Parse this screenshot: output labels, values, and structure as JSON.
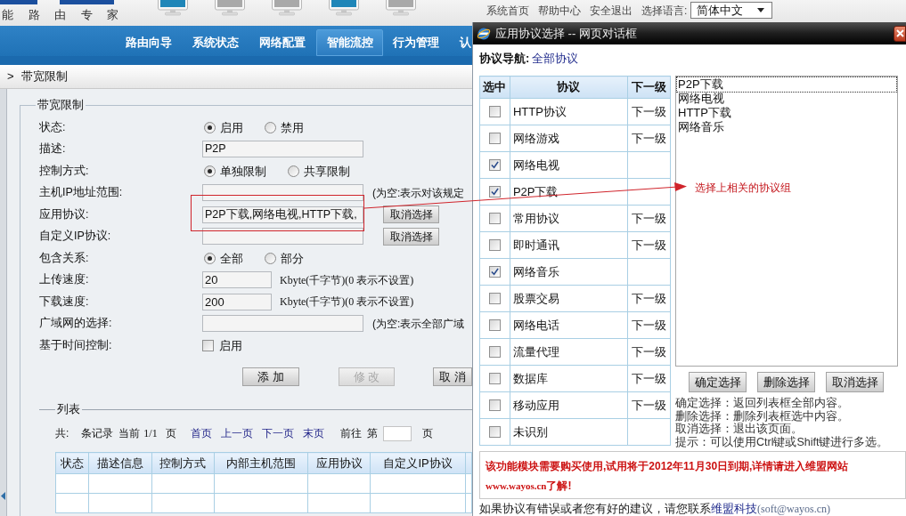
{
  "header": {
    "tagline": "能 路 由 专 家",
    "monitors": [
      {
        "on": true
      },
      {
        "on": false
      },
      {
        "on": false
      },
      {
        "on": true
      },
      {
        "on": false
      }
    ],
    "links": [
      "系统首页",
      "帮助中心",
      "安全退出"
    ],
    "language_label": "选择语言:",
    "language_value": "简体中文"
  },
  "nav": {
    "tabs": [
      {
        "label": "路由向导",
        "selected": false
      },
      {
        "label": "系统状态",
        "selected": false
      },
      {
        "label": "网络配置",
        "selected": false
      },
      {
        "label": "智能流控",
        "selected": true
      },
      {
        "label": "行为管理",
        "selected": false
      },
      {
        "label": "认",
        "selected": false
      }
    ]
  },
  "breadcrumb": {
    "separator": ">",
    "current": "带宽限制"
  },
  "form": {
    "legend": "带宽限制",
    "rows": [
      {
        "kind": "radio",
        "label": "状态:",
        "options": [
          {
            "label": "启用",
            "selected": true
          },
          {
            "label": "禁用",
            "selected": false
          }
        ]
      },
      {
        "kind": "text",
        "label": "描述:",
        "value": "P2P"
      },
      {
        "kind": "radio",
        "label": "控制方式:",
        "options": [
          {
            "label": "单独限制",
            "selected": true
          },
          {
            "label": "共享限制",
            "selected": false
          }
        ]
      },
      {
        "kind": "text",
        "label": "主机IP地址范围:",
        "hint": "(为空:表示对该规定"
      },
      {
        "kind": "text",
        "label": "应用协议:",
        "value": "P2P下载,网络电视,HTTP下载,",
        "button": "取消选择"
      },
      {
        "kind": "text",
        "label": "自定义IP协议:",
        "button": "取消选择"
      },
      {
        "kind": "radio",
        "label": "包含关系:",
        "options": [
          {
            "label": "全部",
            "selected": true
          },
          {
            "label": "部分",
            "selected": false
          }
        ]
      },
      {
        "kind": "speed",
        "label": "上传速度:",
        "value": "20",
        "unit": "Kbyte(千字节)(0 表示不设置)"
      },
      {
        "kind": "speed",
        "label": "下载速度:",
        "value": "200",
        "unit": "Kbyte(千字节)(0 表示不设置)"
      },
      {
        "kind": "text",
        "label": "广域网的选择:",
        "hint": "(为空:表示全部广域"
      },
      {
        "kind": "checkbox",
        "label": "基于时间控制:",
        "checked": false,
        "text": "启用"
      }
    ],
    "buttons": [
      {
        "label": "添 加",
        "disabled": false
      },
      {
        "label": "修 改",
        "disabled": true
      },
      {
        "label": "取 消",
        "disabled": false
      }
    ]
  },
  "list": {
    "legend": "列表",
    "pager": {
      "total_label": "共:",
      "records_label": "条记录",
      "current_label": "当前",
      "page": "1/1",
      "page_unit": "页",
      "links": [
        "首页",
        "上一页",
        "下一页",
        "末页"
      ],
      "goto_label": "前往",
      "goto_prefix": "第",
      "goto_suffix": "页"
    },
    "table": {
      "columns": [
        "状态",
        "描述信息",
        "控制方式",
        "内部主机范围",
        "应用协议",
        "自定义IP协议"
      ]
    }
  },
  "dialog": {
    "title": "应用协议选择 -- 网页对话框",
    "nav_label": "协议导航:",
    "nav_link": "全部协议",
    "columns": [
      "选中",
      "协议",
      "下一级"
    ],
    "rows": [
      {
        "name": "HTTP协议",
        "checked": false,
        "next": "下一级"
      },
      {
        "name": "网络游戏",
        "checked": false,
        "next": "下一级"
      },
      {
        "name": "网络电视",
        "checked": true
      },
      {
        "name": "P2P下载",
        "checked": true
      },
      {
        "name": "常用协议",
        "checked": false,
        "next": "下一级"
      },
      {
        "name": "即时通讯",
        "checked": false,
        "next": "下一级"
      },
      {
        "name": "网络音乐",
        "checked": true
      },
      {
        "name": "股票交易",
        "checked": false,
        "next": "下一级"
      },
      {
        "name": "网络电话",
        "checked": false,
        "next": "下一级"
      },
      {
        "name": "流量代理",
        "checked": false,
        "next": "下一级"
      },
      {
        "name": "数据库",
        "checked": false,
        "next": "下一级"
      },
      {
        "name": "移动应用",
        "checked": false,
        "next": "下一级"
      },
      {
        "name": "未识别",
        "checked": false
      }
    ],
    "selected_list": [
      {
        "label": "P2P下载",
        "focused": true
      },
      {
        "label": "网络电视",
        "focused": false
      },
      {
        "label": "HTTP下载",
        "focused": false
      },
      {
        "label": "网络音乐",
        "focused": false
      }
    ],
    "buttons": [
      "确定选择",
      "删除选择",
      "取消选择"
    ],
    "help": [
      "确定选择：返回列表框全部内容。",
      "删除选择：删除列表框选中内容。",
      "取消选择：退出该页面。",
      "提示：可以使用Ctrl键或Shift键进行多选。"
    ],
    "notice": {
      "text": "该功能模块需要购买使用,试用将于2012年11月30日到期,详情请进入维盟网站",
      "url": "www.wayos.cn",
      "tail": "了解!"
    },
    "contact": {
      "text": "如果协议有错误或者您有好的建议，请您联系",
      "link": "维盟科技",
      "email": "(soft@wayos.cn)"
    }
  },
  "annotation": {
    "text": "选择上相关的协议组"
  }
}
